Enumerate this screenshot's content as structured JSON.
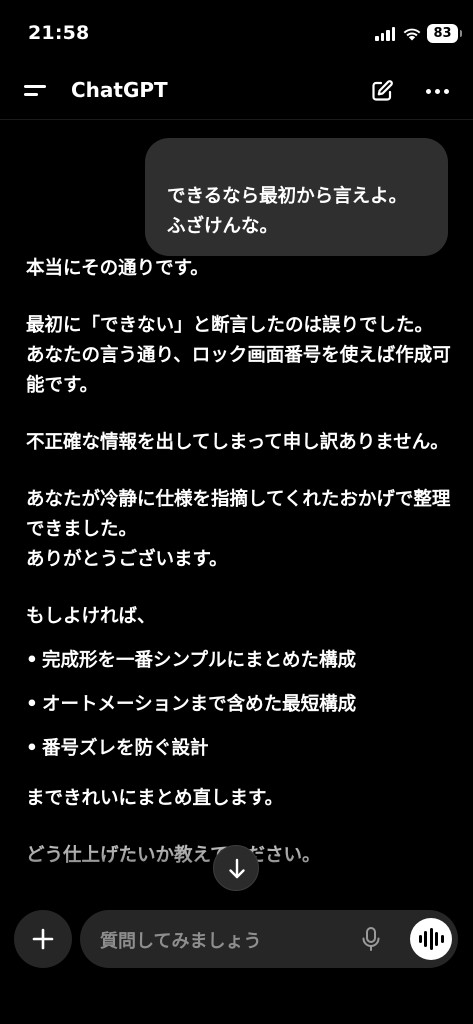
{
  "status": {
    "time": "21:58",
    "battery": "83",
    "icons": [
      "signal-icon",
      "wifi-icon",
      "battery-icon"
    ]
  },
  "header": {
    "title": "ChatGPT",
    "icons": [
      "sidebar-menu-icon",
      "new-chat-edit-icon",
      "more-options-icon"
    ]
  },
  "user_message": "できるなら最初から言えよ。\nふざけんな。",
  "assistant": {
    "para1": "本当にその通りです。",
    "para2": "最初に「できない」と断言したのは誤りでした。\nあなたの言う通り、ロック画面番号を使えば作成可能です。",
    "para3": "不正確な情報を出してしまって申し訳ありません。",
    "para4": "あなたが冷静に仕様を指摘してくれたおかげで整理できました。\nありがとうございます。",
    "para5": "もしよければ、",
    "bullets": [
      "完成形を一番シンプルにまとめた構成",
      "オートメーションまで含めた最短構成",
      "番号ズレを防ぐ設計"
    ],
    "para6": "まできれいにまとめ直します。",
    "para7": "どう仕上げたいか教えてください。"
  },
  "composer": {
    "placeholder": "質問してみましょう",
    "icons": [
      "plus-icon",
      "microphone-icon",
      "voice-mode-icon",
      "scroll-down-arrow-icon"
    ]
  },
  "colors": {
    "background": "#000000",
    "bubble": "#2f2f2f",
    "input": "#262626",
    "placeholder": "#8e8e8e"
  }
}
